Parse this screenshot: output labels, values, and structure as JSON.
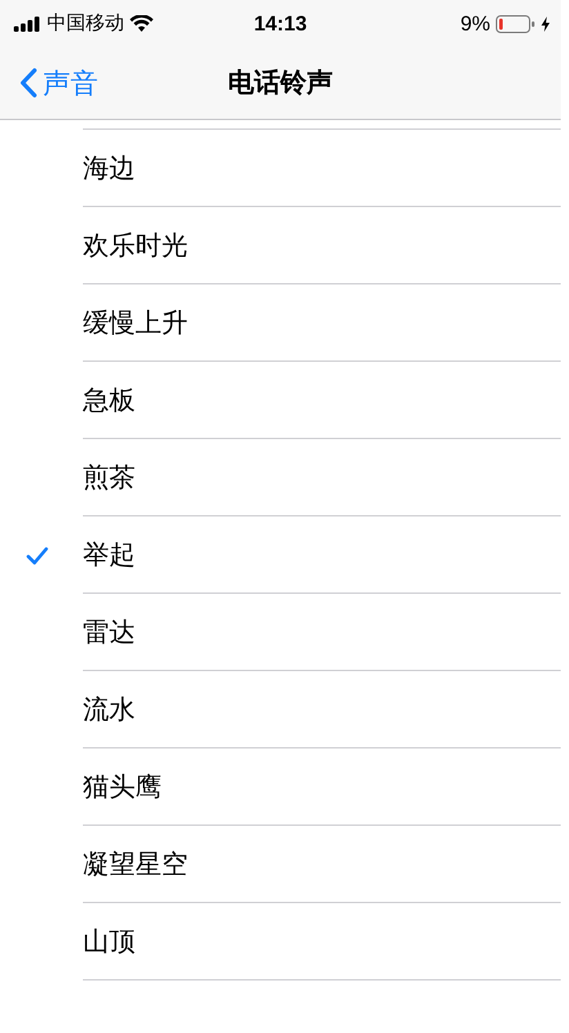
{
  "status_bar": {
    "carrier": "中国移动",
    "time": "14:13",
    "battery": "9%"
  },
  "nav": {
    "back": "声音",
    "title": "电话铃声"
  },
  "ringtones": [
    {
      "name": "海边",
      "selected": false
    },
    {
      "name": "欢乐时光",
      "selected": false
    },
    {
      "name": "缓慢上升",
      "selected": false
    },
    {
      "name": "急板",
      "selected": false
    },
    {
      "name": "煎茶",
      "selected": false
    },
    {
      "name": "举起",
      "selected": true
    },
    {
      "name": "雷达",
      "selected": false
    },
    {
      "name": "流水",
      "selected": false
    },
    {
      "name": "猫头鹰",
      "selected": false
    },
    {
      "name": "凝望星空",
      "selected": false
    },
    {
      "name": "山顶",
      "selected": false
    }
  ]
}
